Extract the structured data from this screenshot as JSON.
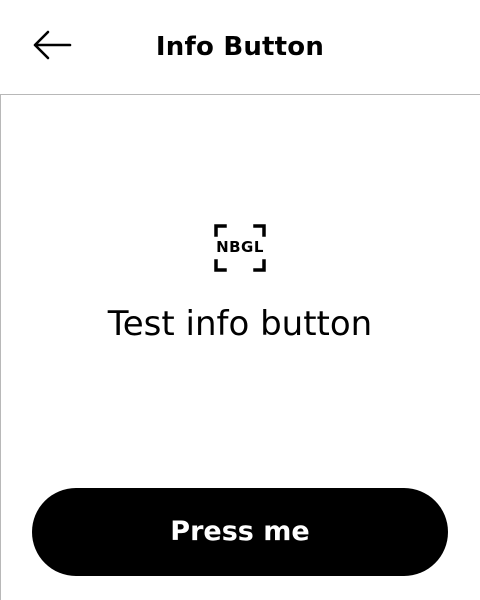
{
  "header": {
    "back_icon": "arrow-left-icon",
    "title": "Info Button"
  },
  "content": {
    "logo_icon": "nbgl-logo-icon",
    "logo_text": "NBGL",
    "message": "Test info button"
  },
  "footer": {
    "button_label": "Press me"
  },
  "colors": {
    "background": "#ffffff",
    "text": "#000000",
    "button_background": "#000000",
    "button_text": "#ffffff",
    "divider": "#b8b8b8"
  }
}
